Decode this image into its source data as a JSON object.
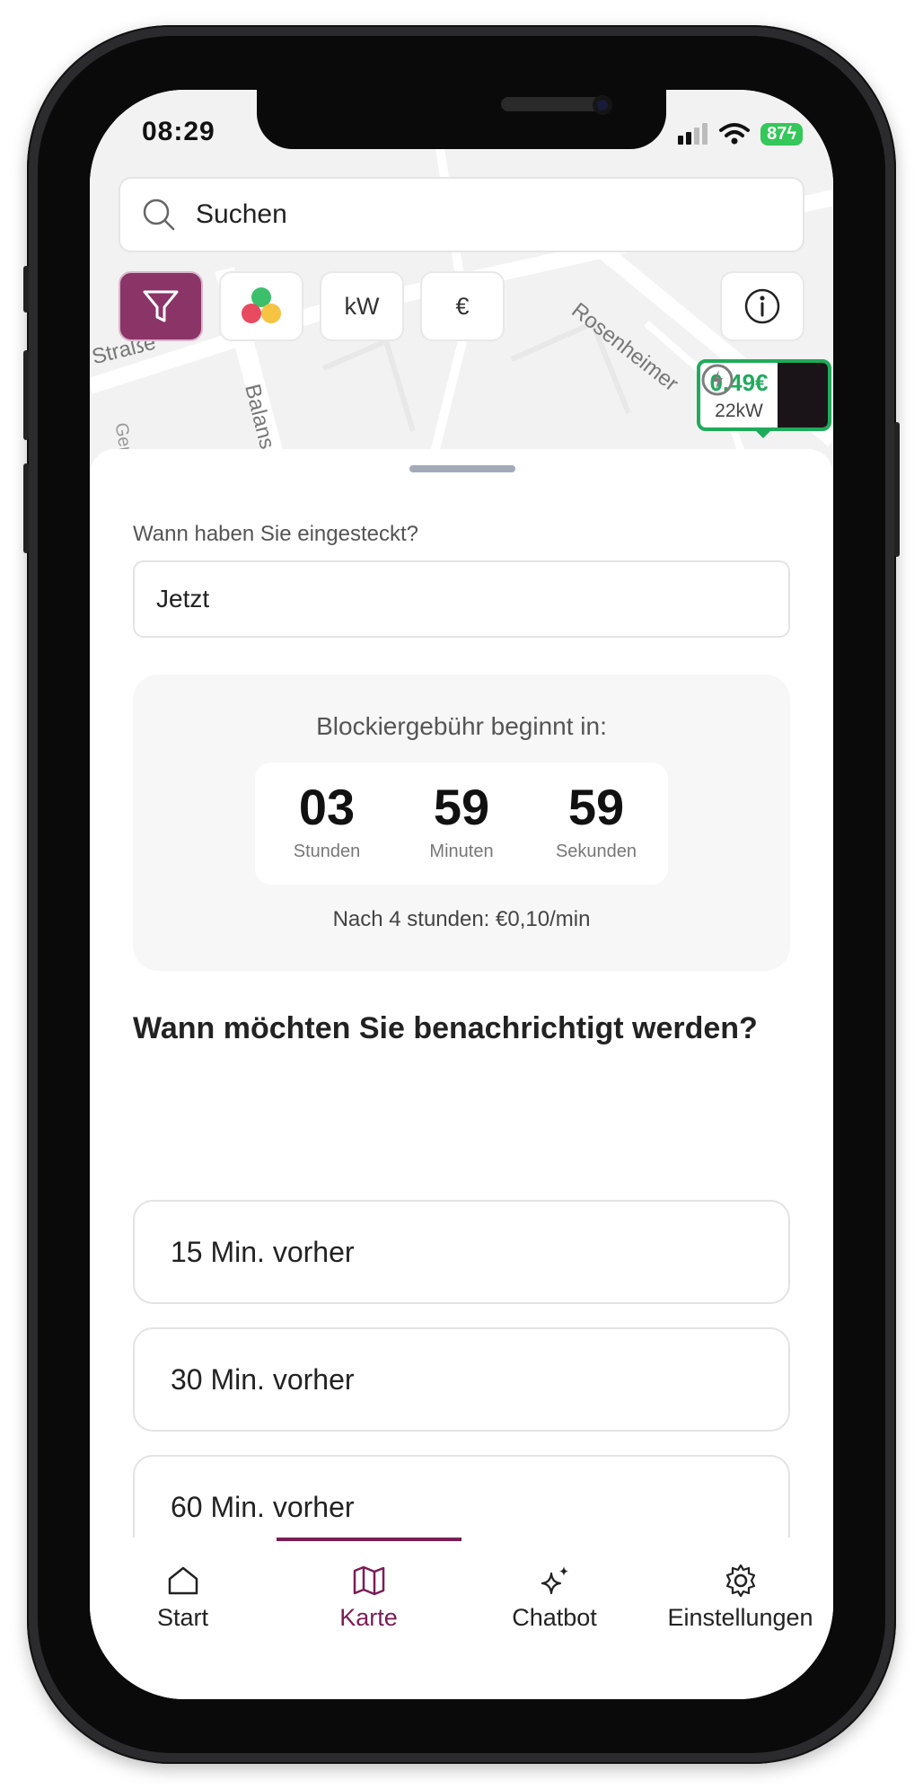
{
  "status_bar": {
    "time": "08:29",
    "battery": "87"
  },
  "search": {
    "placeholder": "Suchen"
  },
  "filters": {
    "kw_label": "kW",
    "price_label": "€"
  },
  "map": {
    "street_1": "Straße",
    "street_2": "Balans",
    "street_3": "Rosenheimer",
    "street_4": "Ger",
    "marker": {
      "price": "0.49€",
      "power": "22kW"
    }
  },
  "plugin": {
    "label": "Wann haben Sie eingesteckt?",
    "value": "Jetzt"
  },
  "blocking_fee": {
    "title": "Blockiergebühr beginnt in:",
    "hours": "03",
    "hours_label": "Stunden",
    "minutes": "59",
    "minutes_label": "Minuten",
    "seconds": "59",
    "seconds_label": "Sekunden",
    "note": "Nach 4 stunden: €0,10/min"
  },
  "notify": {
    "title": "Wann möchten Sie benachrichtigt werden?",
    "options": [
      "15 Min. vorher",
      "30 Min. vorher",
      "60 Min. vorher"
    ]
  },
  "tabs": [
    {
      "label": "Start",
      "icon": "home-icon"
    },
    {
      "label": "Karte",
      "icon": "map-icon",
      "active": true
    },
    {
      "label": "Chatbot",
      "icon": "sparkle-icon"
    },
    {
      "label": "Einstellungen",
      "icon": "gear-icon"
    }
  ],
  "colors": {
    "accent": "#7a1e54",
    "filter_bg": "#8b3468",
    "marker_green": "#1fab5b"
  }
}
